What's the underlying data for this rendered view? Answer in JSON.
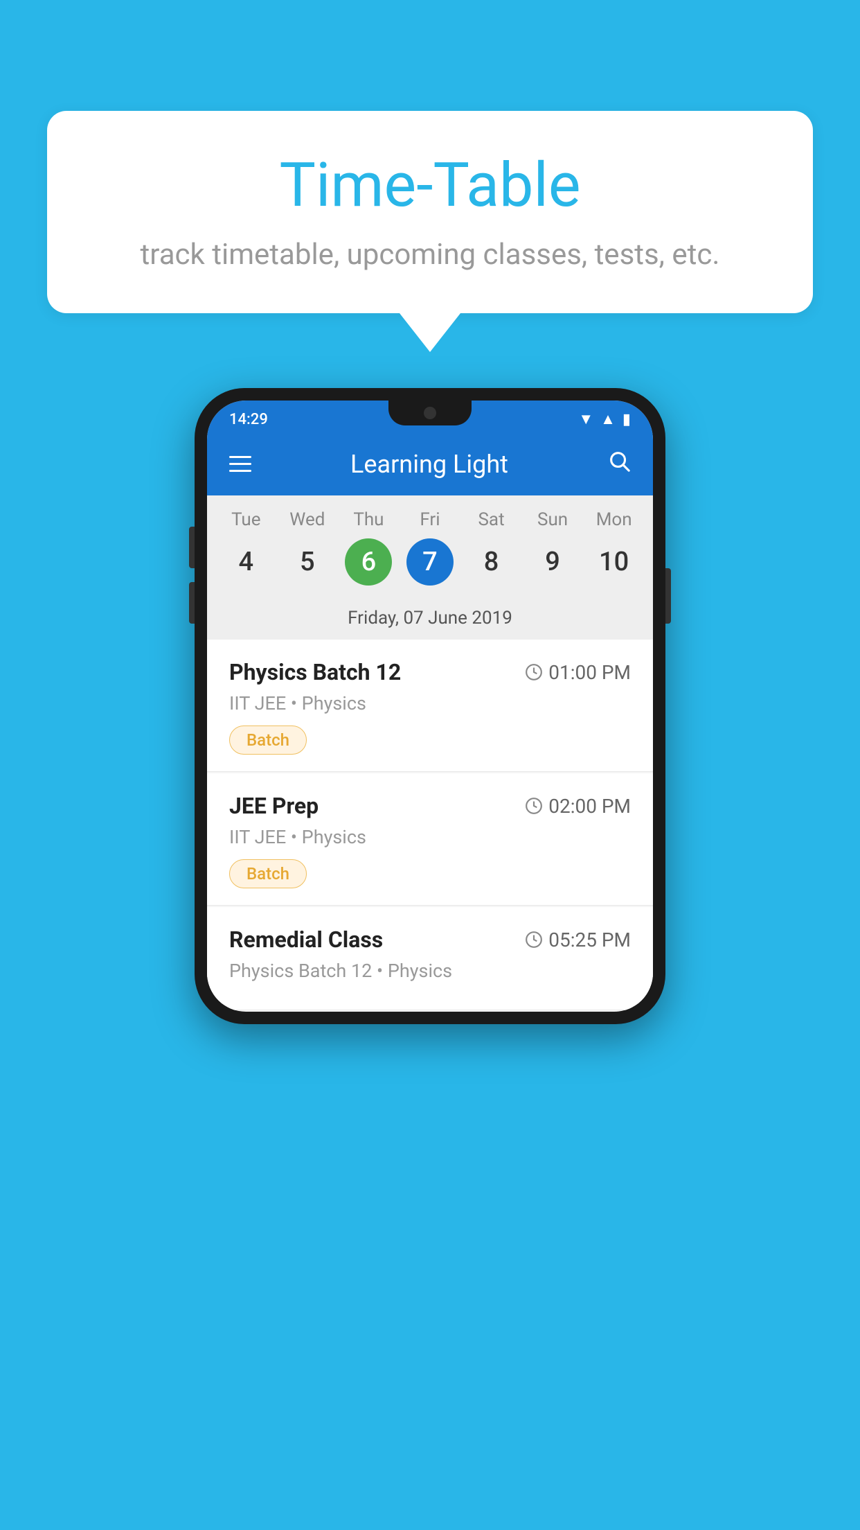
{
  "background": {
    "color": "#29b6e8"
  },
  "speech_bubble": {
    "title": "Time-Table",
    "subtitle": "track timetable, upcoming classes, tests, etc."
  },
  "phone": {
    "status_bar": {
      "time": "14:29",
      "wifi_icon": "▼",
      "signal_icon": "▲",
      "battery_icon": "▮"
    },
    "header": {
      "app_title": "Learning Light",
      "hamburger_label": "menu",
      "search_label": "search"
    },
    "calendar": {
      "days": [
        {
          "name": "Tue",
          "num": "4",
          "state": "normal"
        },
        {
          "name": "Wed",
          "num": "5",
          "state": "normal"
        },
        {
          "name": "Thu",
          "num": "6",
          "state": "today"
        },
        {
          "name": "Fri",
          "num": "7",
          "state": "selected"
        },
        {
          "name": "Sat",
          "num": "8",
          "state": "normal"
        },
        {
          "name": "Sun",
          "num": "9",
          "state": "normal"
        },
        {
          "name": "Mon",
          "num": "10",
          "state": "normal"
        }
      ],
      "selected_date_label": "Friday, 07 June 2019"
    },
    "schedule": {
      "items": [
        {
          "title": "Physics Batch 12",
          "time": "01:00 PM",
          "subtitle": "IIT JEE • Physics",
          "badge": "Batch"
        },
        {
          "title": "JEE Prep",
          "time": "02:00 PM",
          "subtitle": "IIT JEE • Physics",
          "badge": "Batch"
        },
        {
          "title": "Remedial Class",
          "time": "05:25 PM",
          "subtitle": "Physics Batch 12 • Physics",
          "badge": null
        }
      ]
    }
  }
}
